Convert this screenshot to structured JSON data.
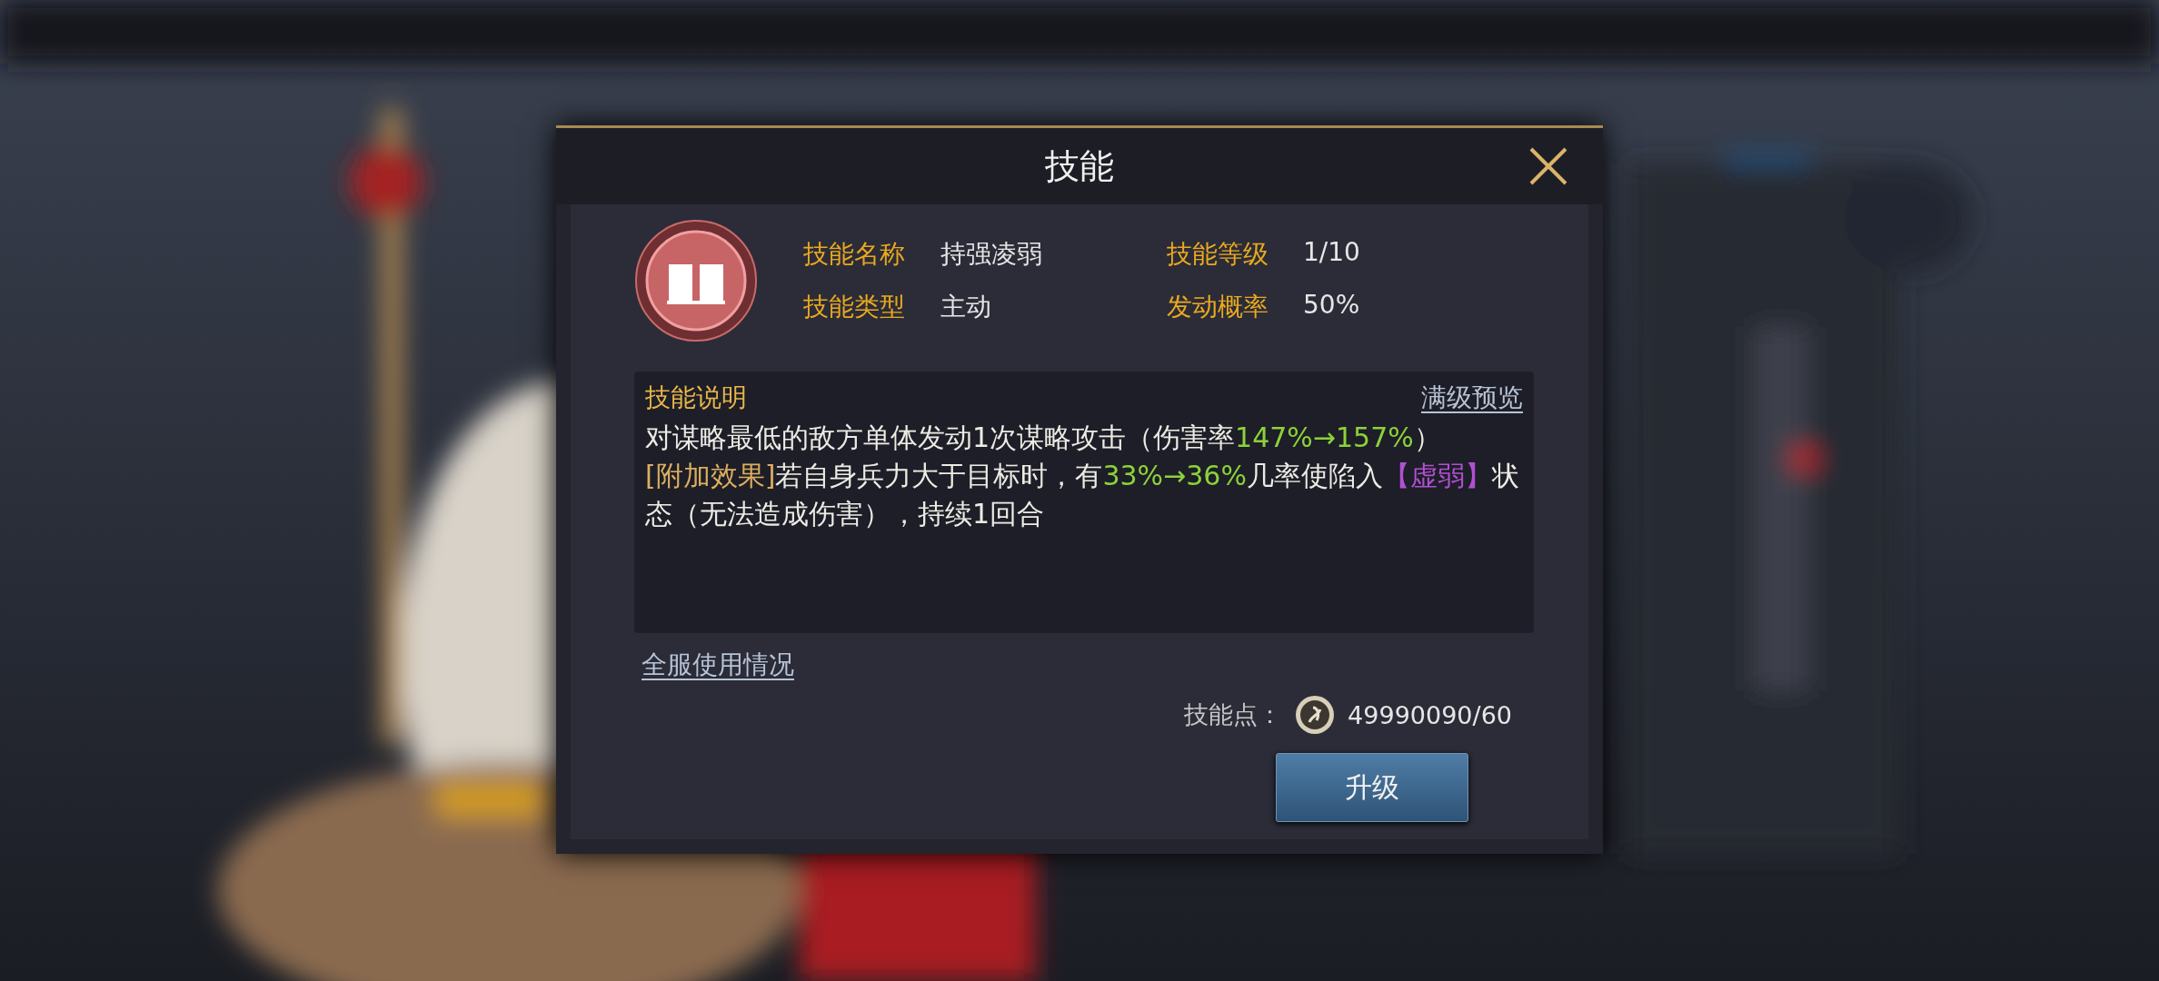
{
  "dialog": {
    "title": "技能",
    "skill": {
      "fields": [
        {
          "label": "技能名称",
          "value": "持强凌弱"
        },
        {
          "label": "技能等级",
          "value": "1/10"
        },
        {
          "label": "技能类型",
          "value": "主动"
        },
        {
          "label": "发动概率",
          "value": "50%"
        }
      ]
    },
    "description": {
      "title": "技能说明",
      "link": "满级预览",
      "segments": [
        {
          "kind": "plain",
          "text": "对谋略最低的敌方单体发动1次谋略攻击（伤害率"
        },
        {
          "kind": "green",
          "text": "147%→157%"
        },
        {
          "kind": "plain",
          "text": "）"
        },
        {
          "kind": "break"
        },
        {
          "kind": "gold",
          "text": "[附加效果]"
        },
        {
          "kind": "plain",
          "text": "若自身兵力大于目标时，有"
        },
        {
          "kind": "green",
          "text": "33%→36%"
        },
        {
          "kind": "plain",
          "text": "几率使陷入"
        },
        {
          "kind": "purple",
          "text": "【虚弱】"
        },
        {
          "kind": "plain",
          "text": "状态（无法造成伤害），持续1回合"
        }
      ]
    },
    "usage_link": "全服使用情况",
    "points": {
      "label": "技能点：",
      "value": "49990090/60"
    },
    "upgrade_button": "升级"
  }
}
